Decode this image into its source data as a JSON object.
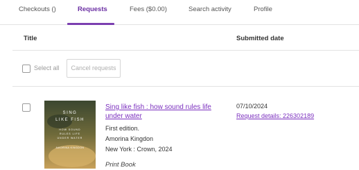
{
  "tabs": [
    {
      "label": "Checkouts ()",
      "active": false
    },
    {
      "label": "Requests",
      "active": true
    },
    {
      "label": "Fees ($0.00)",
      "active": false
    },
    {
      "label": "Search activity",
      "active": false
    },
    {
      "label": "Profile",
      "active": false
    }
  ],
  "table": {
    "col_title": "Title",
    "col_submitted": "Submitted date"
  },
  "controls": {
    "select_all": "Select all",
    "cancel_requests": "Cancel requests"
  },
  "request": {
    "title": "Sing like fish : how sound rules life under water",
    "edition": "First edition.",
    "author": "Amorina Kingdon",
    "publication": "New York : Crown, 2024",
    "format": "Print Book",
    "submitted_date": "07/10/2024",
    "details_link": "Request details: 226302189",
    "cover": {
      "line1": "SING",
      "line2": "LIKE FISH",
      "line3": "HOW SOUND",
      "line4": "RULES LIFE",
      "line5": "UNDER WATER",
      "author": "AMORINA KINGDON"
    }
  },
  "colors": {
    "accent": "#7b3fb0",
    "link": "#7b2fbe",
    "divider": "#e2e2e2"
  }
}
